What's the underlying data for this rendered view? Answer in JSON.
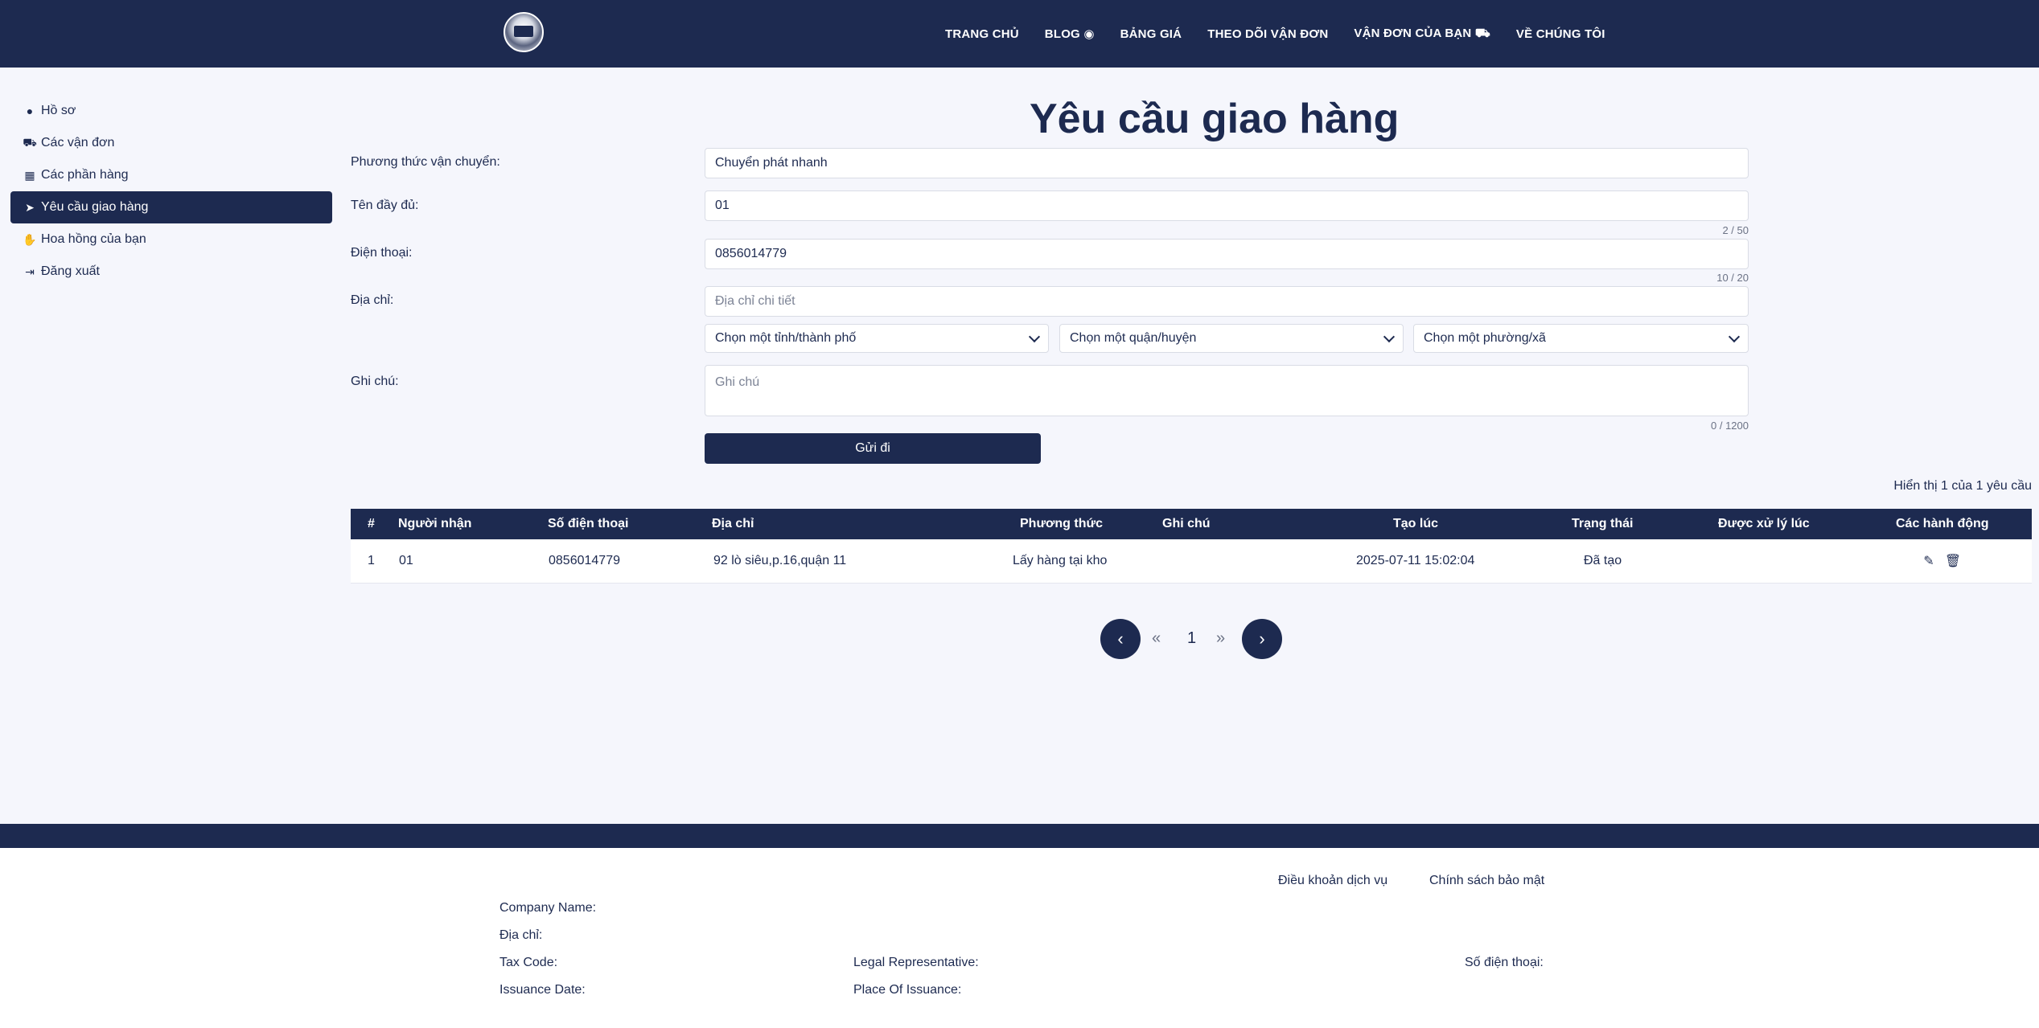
{
  "nav": {
    "items": [
      "TRANG CHỦ",
      "BLOG",
      "BẢNG GIÁ",
      "THEO DÕI VẬN ĐƠN",
      "VẬN ĐƠN CỦA BẠN",
      "VỀ CHÚNG TÔI"
    ],
    "icons": {
      "blog": "rss-icon",
      "your_orders": "truck-icon"
    }
  },
  "sidebar": {
    "items": [
      {
        "label": "Hồ sơ",
        "icon": "user-circle-icon"
      },
      {
        "label": "Các vận đơn",
        "icon": "truck-icon"
      },
      {
        "label": "Các phần hàng",
        "icon": "boxes-icon"
      },
      {
        "label": "Yêu cầu giao hàng",
        "icon": "paper-plane-icon",
        "active": true
      },
      {
        "label": "Hoa hồng của bạn",
        "icon": "hand-holding-icon"
      },
      {
        "label": "Đăng xuất",
        "icon": "sign-out-icon"
      }
    ]
  },
  "page": {
    "title": "Yêu cầu giao hàng"
  },
  "form": {
    "shipping_method": {
      "label": "Phương thức vận chuyển:",
      "value": "Chuyển phát nhanh"
    },
    "full_name": {
      "label": "Tên đầy đủ:",
      "value": "01",
      "counter": "2 / 50"
    },
    "phone": {
      "label": "Điện thoại:",
      "value": "0856014779",
      "counter": "10 / 20"
    },
    "address": {
      "label": "Địa chỉ:",
      "placeholder": "Địa chỉ chi tiết"
    },
    "province": {
      "value": "Chọn một tỉnh/thành phố"
    },
    "district": {
      "value": "Chọn một quận/huyện"
    },
    "ward": {
      "value": "Chọn một phường/xã"
    },
    "note": {
      "label": "Ghi chú:",
      "placeholder": "Ghi chú",
      "counter": "0 / 1200"
    },
    "submit_label": "Gửi đi"
  },
  "table": {
    "summary": "Hiển thị 1 của 1 yêu cầu",
    "columns": [
      "#",
      "Người nhận",
      "Số điện thoại",
      "Địa chỉ",
      "Phương thức",
      "Ghi chú",
      "Tạo lúc",
      "Trạng thái",
      "Được xử lý lúc",
      "Các hành động"
    ],
    "rows": [
      {
        "index": "1",
        "recipient": "01",
        "phone": "0856014779",
        "address": "92 lò siêu,p.16,quận 11",
        "method": "Lấy hàng tại kho",
        "note": "",
        "created": "2025-07-11 15:02:04",
        "status": "Đã tạo",
        "processed": ""
      }
    ]
  },
  "pagination": {
    "first": "«",
    "page": "1",
    "last": "»"
  },
  "footer": {
    "links": [
      "Điều khoản dịch vụ",
      "Chính sách bảo mật"
    ],
    "company_name_label": "Company Name:",
    "address_label": "Địa chỉ:",
    "tax_code_label": "Tax Code:",
    "legal_rep_label": "Legal Representative:",
    "phone_label": "Số điện thoại:",
    "issuance_date_label": "Issuance Date:",
    "place_of_issuance_label": "Place Of Issuance:"
  }
}
